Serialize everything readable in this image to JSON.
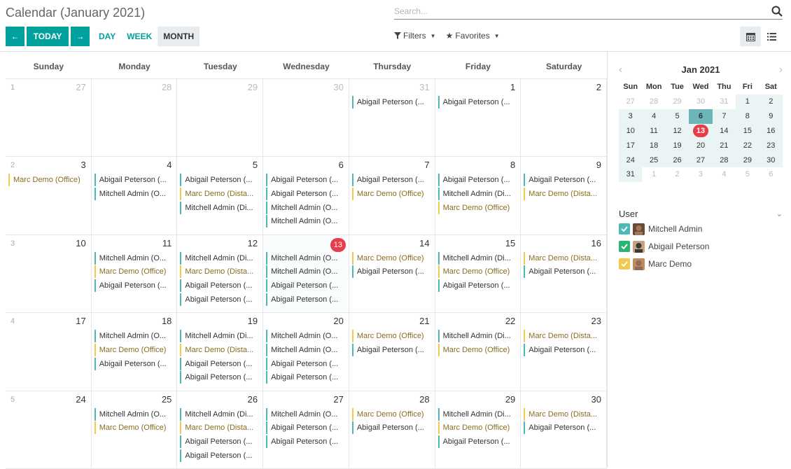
{
  "title": "Calendar (January 2021)",
  "nav": {
    "prev": "←",
    "today": "TODAY",
    "next": "→"
  },
  "scales": [
    "DAY",
    "WEEK",
    "MONTH"
  ],
  "search": {
    "placeholder": "Search..."
  },
  "filters": {
    "filters_label": "Filters",
    "favorites_label": "Favorites"
  },
  "day_names": [
    "Sunday",
    "Monday",
    "Tuesday",
    "Wednesday",
    "Thursday",
    "Friday",
    "Saturday"
  ],
  "weeks": [
    {
      "num": "1",
      "days": [
        {
          "d": "27",
          "other": true,
          "ev": []
        },
        {
          "d": "28",
          "other": true,
          "ev": []
        },
        {
          "d": "29",
          "other": true,
          "ev": []
        },
        {
          "d": "30",
          "other": true,
          "ev": []
        },
        {
          "d": "31",
          "other": true,
          "ev": [
            [
              "Abigail Peterson (...",
              1
            ]
          ]
        },
        {
          "d": "1",
          "ev": [
            [
              "Abigail Peterson (...",
              1
            ]
          ]
        },
        {
          "d": "2",
          "ev": []
        }
      ]
    },
    {
      "num": "2",
      "days": [
        {
          "d": "3",
          "ev": [
            [
              "Marc Demo (Office)",
              2
            ]
          ]
        },
        {
          "d": "4",
          "ev": [
            [
              "Abigail Peterson (...",
              1
            ],
            [
              "Mitchell Admin (O...",
              1
            ]
          ]
        },
        {
          "d": "5",
          "ev": [
            [
              "Abigail Peterson (...",
              1
            ],
            [
              "Marc Demo (Dista...",
              2
            ],
            [
              "Mitchell Admin (Di...",
              1
            ]
          ]
        },
        {
          "d": "6",
          "ev": [
            [
              "Abigail Peterson (...",
              1
            ],
            [
              "Abigail Peterson (...",
              1
            ],
            [
              "Mitchell Admin (O...",
              1
            ],
            [
              "Mitchell Admin (O...",
              1
            ]
          ]
        },
        {
          "d": "7",
          "ev": [
            [
              "Abigail Peterson (...",
              1
            ],
            [
              "Marc Demo (Office)",
              2
            ]
          ]
        },
        {
          "d": "8",
          "ev": [
            [
              "Abigail Peterson (...",
              1
            ],
            [
              "Mitchell Admin (Di...",
              1
            ],
            [
              "Marc Demo (Office)",
              2
            ]
          ]
        },
        {
          "d": "9",
          "ev": [
            [
              "Abigail Peterson (...",
              1
            ],
            [
              "Marc Demo (Dista...",
              2
            ]
          ]
        }
      ]
    },
    {
      "num": "3",
      "days": [
        {
          "d": "10",
          "ev": []
        },
        {
          "d": "11",
          "ev": [
            [
              "Mitchell Admin (O...",
              1
            ],
            [
              "Marc Demo (Office)",
              2
            ],
            [
              "Abigail Peterson (...",
              1
            ]
          ]
        },
        {
          "d": "12",
          "ev": [
            [
              "Mitchell Admin (Di...",
              1
            ],
            [
              "Marc Demo (Dista...",
              2
            ],
            [
              "Abigail Peterson (...",
              1
            ],
            [
              "Abigail Peterson (...",
              1
            ]
          ]
        },
        {
          "d": "13",
          "today": true,
          "ev": [
            [
              "Mitchell Admin (O...",
              1
            ],
            [
              "Mitchell Admin (O...",
              1
            ],
            [
              "Abigail Peterson (...",
              1
            ],
            [
              "Abigail Peterson (...",
              1
            ]
          ]
        },
        {
          "d": "14",
          "ev": [
            [
              "Marc Demo (Office)",
              2
            ],
            [
              "Abigail Peterson (...",
              1
            ]
          ]
        },
        {
          "d": "15",
          "ev": [
            [
              "Mitchell Admin (Di...",
              1
            ],
            [
              "Marc Demo (Office)",
              2
            ],
            [
              "Abigail Peterson (...",
              1
            ]
          ]
        },
        {
          "d": "16",
          "ev": [
            [
              "Marc Demo (Dista...",
              2
            ],
            [
              "Abigail Peterson (...",
              1
            ]
          ]
        }
      ]
    },
    {
      "num": "4",
      "days": [
        {
          "d": "17",
          "ev": []
        },
        {
          "d": "18",
          "ev": [
            [
              "Mitchell Admin (O...",
              1
            ],
            [
              "Marc Demo (Office)",
              2
            ],
            [
              "Abigail Peterson (...",
              1
            ]
          ]
        },
        {
          "d": "19",
          "ev": [
            [
              "Mitchell Admin (Di...",
              1
            ],
            [
              "Marc Demo (Dista...",
              2
            ],
            [
              "Abigail Peterson (...",
              1
            ],
            [
              "Abigail Peterson (...",
              1
            ]
          ]
        },
        {
          "d": "20",
          "ev": [
            [
              "Mitchell Admin (O...",
              1
            ],
            [
              "Mitchell Admin (O...",
              1
            ],
            [
              "Abigail Peterson (...",
              1
            ],
            [
              "Abigail Peterson (...",
              1
            ]
          ]
        },
        {
          "d": "21",
          "ev": [
            [
              "Marc Demo (Office)",
              2
            ],
            [
              "Abigail Peterson (...",
              1
            ]
          ]
        },
        {
          "d": "22",
          "ev": [
            [
              "Mitchell Admin (Di...",
              1
            ],
            [
              "Marc Demo (Office)",
              2
            ]
          ]
        },
        {
          "d": "23",
          "ev": [
            [
              "Marc Demo (Dista...",
              2
            ],
            [
              "Abigail Peterson (...",
              1
            ]
          ]
        }
      ]
    },
    {
      "num": "5",
      "days": [
        {
          "d": "24",
          "ev": []
        },
        {
          "d": "25",
          "ev": [
            [
              "Mitchell Admin (O...",
              1
            ],
            [
              "Marc Demo (Office)",
              2
            ]
          ]
        },
        {
          "d": "26",
          "ev": [
            [
              "Mitchell Admin (Di...",
              1
            ],
            [
              "Marc Demo (Dista...",
              2
            ],
            [
              "Abigail Peterson (...",
              1
            ],
            [
              "Abigail Peterson (...",
              1
            ]
          ]
        },
        {
          "d": "27",
          "ev": [
            [
              "Mitchell Admin (O...",
              1
            ],
            [
              "Abigail Peterson (...",
              1
            ],
            [
              "Abigail Peterson (...",
              1
            ]
          ]
        },
        {
          "d": "28",
          "ev": [
            [
              "Marc Demo (Office)",
              2
            ],
            [
              "Abigail Peterson (...",
              1
            ]
          ]
        },
        {
          "d": "29",
          "ev": [
            [
              "Mitchell Admin (Di...",
              1
            ],
            [
              "Marc Demo (Office)",
              2
            ],
            [
              "Abigail Peterson (...",
              1
            ]
          ]
        },
        {
          "d": "30",
          "ev": [
            [
              "Marc Demo (Dista...",
              2
            ],
            [
              "Abigail Peterson (...",
              1
            ]
          ]
        }
      ]
    }
  ],
  "mini": {
    "title": "Jan 2021",
    "prev": "‹",
    "next": "›",
    "dow": [
      "Sun",
      "Mon",
      "Tue",
      "Wed",
      "Thu",
      "Fri",
      "Sat"
    ],
    "rows": [
      [
        [
          "27",
          "o"
        ],
        [
          "28",
          "o"
        ],
        [
          "29",
          "o"
        ],
        [
          "30",
          "o"
        ],
        [
          "31",
          "o"
        ],
        [
          "1",
          "b"
        ],
        [
          "2",
          "b"
        ]
      ],
      [
        [
          "3",
          "b"
        ],
        [
          "4",
          "b"
        ],
        [
          "5",
          "b"
        ],
        [
          "6",
          "s"
        ],
        [
          "7",
          "b"
        ],
        [
          "8",
          "b"
        ],
        [
          "9",
          "b"
        ]
      ],
      [
        [
          "10",
          "b"
        ],
        [
          "11",
          "b"
        ],
        [
          "12",
          "b"
        ],
        [
          "13",
          "t"
        ],
        [
          "14",
          "b"
        ],
        [
          "15",
          "b"
        ],
        [
          "16",
          "b"
        ]
      ],
      [
        [
          "17",
          "b"
        ],
        [
          "18",
          "b"
        ],
        [
          "19",
          "b"
        ],
        [
          "20",
          "b"
        ],
        [
          "21",
          "b"
        ],
        [
          "22",
          "b"
        ],
        [
          "23",
          "b"
        ]
      ],
      [
        [
          "24",
          "b"
        ],
        [
          "25",
          "b"
        ],
        [
          "26",
          "b"
        ],
        [
          "27",
          "b"
        ],
        [
          "28",
          "b"
        ],
        [
          "29",
          "b"
        ],
        [
          "30",
          "b"
        ]
      ],
      [
        [
          "31",
          "b"
        ],
        [
          "1",
          "o"
        ],
        [
          "2",
          "o"
        ],
        [
          "3",
          "o"
        ],
        [
          "4",
          "o"
        ],
        [
          "5",
          "o"
        ],
        [
          "6",
          "o"
        ]
      ]
    ]
  },
  "users": {
    "label": "User",
    "list": [
      {
        "name": "Mitchell Admin",
        "color": "#4bb9b8"
      },
      {
        "name": "Abigail Peterson",
        "color": "#2ab573"
      },
      {
        "name": "Marc Demo",
        "color": "#f2c94c"
      }
    ]
  },
  "colors": {
    "primary": "#00A09D",
    "today": "#e83c4b"
  }
}
